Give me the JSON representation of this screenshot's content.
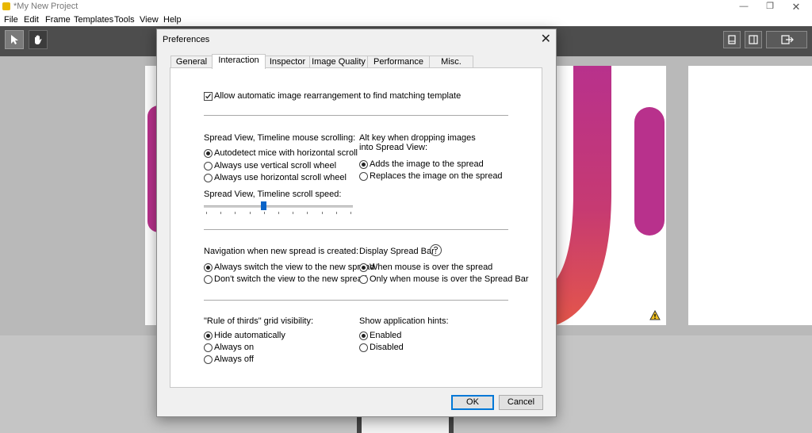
{
  "window": {
    "title": "*My New Project",
    "app_icon": "app-logo-icon"
  },
  "menu": [
    "File",
    "Edit",
    "Frame",
    "Templates",
    "Tools",
    "View",
    "Help"
  ],
  "toolbar": {
    "select_icon": "arrow-pointer-icon",
    "hand_icon": "hand-icon",
    "right_icons": [
      "single-page-view-icon",
      "spread-view-icon",
      "export-icon"
    ]
  },
  "dialog": {
    "title": "Preferences",
    "tabs": [
      "General",
      "Interaction",
      "Inspector",
      "Image Quality",
      "Performance",
      "Misc."
    ],
    "active_tab": "Interaction",
    "auto_rearrange": {
      "label": "Allow automatic image rearrangement to find matching template",
      "checked": true
    },
    "scrolling": {
      "heading": "Spread View, Timeline mouse scrolling:",
      "options": [
        "Autodetect mice with horizontal scroll",
        "Always use vertical scroll wheel",
        "Always use horizontal scroll wheel"
      ],
      "selected": 0
    },
    "scroll_speed": {
      "label": "Spread View, Timeline scroll speed:",
      "value_fraction": 0.4,
      "ticks": 11
    },
    "alt_key": {
      "heading_line1": "Alt key when dropping images",
      "heading_line2": "into Spread View:",
      "options": [
        "Adds the image to the spread",
        "Replaces the image on the spread"
      ],
      "selected": 0
    },
    "navigation": {
      "heading": "Navigation when new spread is created:",
      "options": [
        "Always switch the view to the new spread",
        "Don't switch the view to the new spread"
      ],
      "selected": 0
    },
    "spread_bar": {
      "heading": "Display Spread Bar:",
      "help": "?",
      "options": [
        "When mouse is over the spread",
        "Only when mouse is over the Spread Bar"
      ],
      "selected": 0
    },
    "thirds": {
      "heading": "\"Rule of thirds\" grid visibility:",
      "options": [
        "Hide automatically",
        "Always on",
        "Always off"
      ],
      "selected": 0
    },
    "hints": {
      "heading": "Show application hints:",
      "options": [
        "Enabled",
        "Disabled"
      ],
      "selected": 0
    },
    "ok": "OK",
    "cancel": "Cancel"
  },
  "colors": {
    "accent": "#0a64c8",
    "gradient_top": "#b8318c",
    "gradient_bottom": "#e4564a",
    "warning": "#f0c020"
  }
}
